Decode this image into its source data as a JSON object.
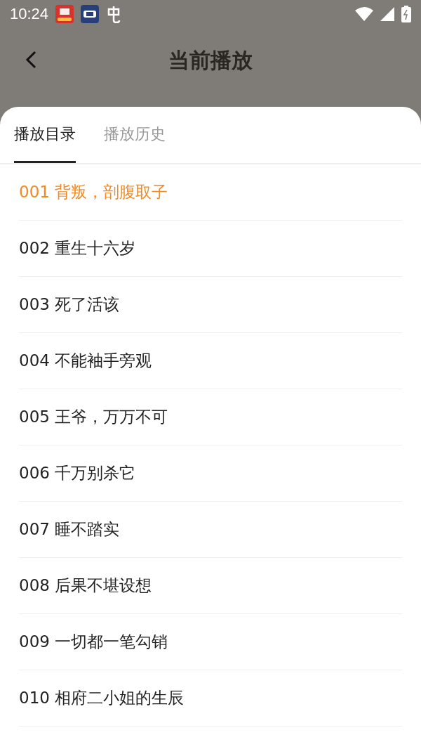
{
  "status_bar": {
    "time": "10:24"
  },
  "header": {
    "title": "当前播放"
  },
  "tabs": [
    {
      "label": "播放目录",
      "selected": true
    },
    {
      "label": "播放历史",
      "selected": false
    }
  ],
  "chapters": [
    {
      "title": "001 背叛，剖腹取子",
      "selected": true
    },
    {
      "title": "002 重生十六岁",
      "selected": false
    },
    {
      "title": "003 死了活该",
      "selected": false
    },
    {
      "title": "004 不能袖手旁观",
      "selected": false
    },
    {
      "title": "005 王爷，万万不可",
      "selected": false
    },
    {
      "title": "006 千万别杀它",
      "selected": false
    },
    {
      "title": "007 睡不踏实",
      "selected": false
    },
    {
      "title": "008 后果不堪设想",
      "selected": false
    },
    {
      "title": "009 一切都一笔勾销",
      "selected": false
    },
    {
      "title": "010 相府二小姐的生辰",
      "selected": false
    }
  ]
}
